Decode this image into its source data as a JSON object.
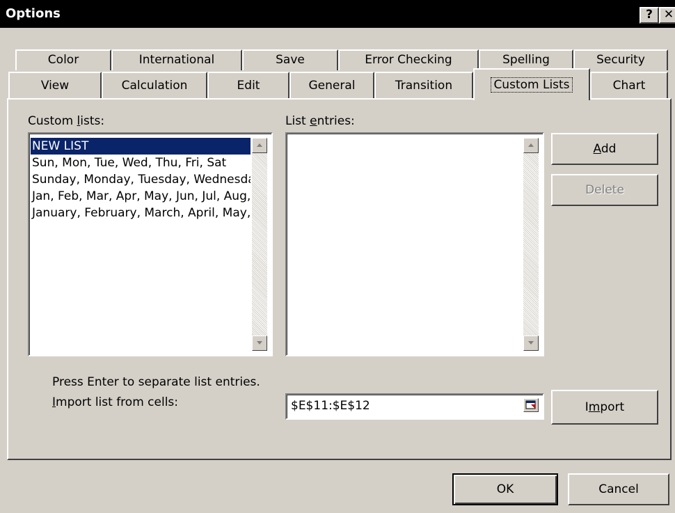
{
  "window": {
    "title": "Options",
    "help_button": "?",
    "close_button": "✕"
  },
  "tabs": {
    "row1": [
      "Color",
      "International",
      "Save",
      "Error Checking",
      "Spelling",
      "Security"
    ],
    "row2": [
      "View",
      "Calculation",
      "Edit",
      "General",
      "Transition",
      "Custom Lists",
      "Chart"
    ],
    "selected": "Custom Lists"
  },
  "custom_lists": {
    "label_pre": "Custom ",
    "label_key": "l",
    "label_post": "ists:",
    "items": [
      "NEW LIST",
      "Sun, Mon, Tue, Wed, Thu, Fri, Sat",
      "Sunday, Monday, Tuesday, Wednesday, Thursday, Friday, Saturday",
      "Jan, Feb, Mar, Apr, May, Jun, Jul, Aug, Sep, Oct, Nov, Dec",
      "January, February, March, April, May, June, July, August, September, October, November, December"
    ],
    "selected_index": 0
  },
  "list_entries": {
    "label_pre": "List ",
    "label_key": "e",
    "label_post": "ntries:",
    "value": ""
  },
  "buttons": {
    "add_key": "A",
    "add_rest": "dd",
    "delete": "Delete",
    "import_pre": "I",
    "import_key": "m",
    "import_post": "port",
    "ok": "OK",
    "cancel": "Cancel"
  },
  "hint": "Press Enter to separate list entries.",
  "import_from_cells": {
    "label_key": "I",
    "label_rest": "mport list from cells:",
    "value": "$E$11:$E$12"
  },
  "colors": {
    "face": "#d4d0c8",
    "selection": "#0a246a",
    "titlebar": "#000000"
  },
  "icons": {
    "scroll_up": "triangle-up",
    "scroll_down": "triangle-down",
    "collapse_dialog": "range-collapse"
  }
}
